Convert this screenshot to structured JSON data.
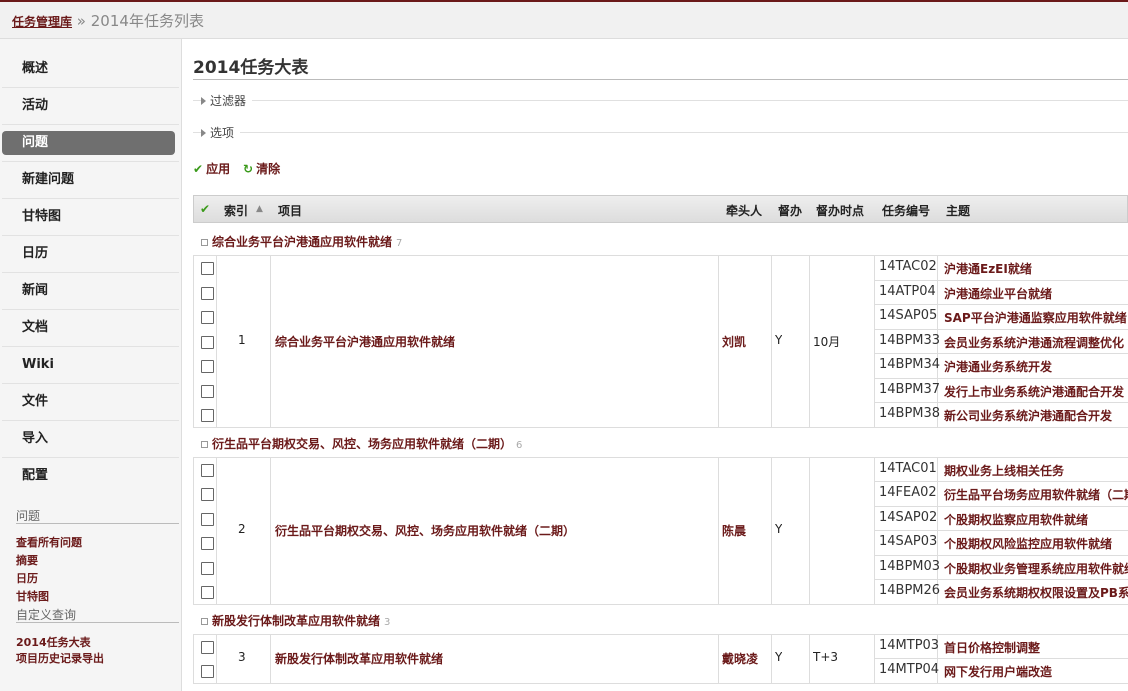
{
  "breadcrumb": {
    "root": "任务管理库",
    "sep": "»",
    "current": "2014年任务列表"
  },
  "sidebar": {
    "items": [
      {
        "label": "概述"
      },
      {
        "label": "活动"
      },
      {
        "label": "问题",
        "active": true
      },
      {
        "label": "新建问题"
      },
      {
        "label": "甘特图"
      },
      {
        "label": "日历"
      },
      {
        "label": "新闻"
      },
      {
        "label": "文档"
      },
      {
        "label": "Wiki"
      },
      {
        "label": "文件"
      },
      {
        "label": "导入"
      },
      {
        "label": "配置"
      }
    ],
    "issues_heading": "问题",
    "issue_links": [
      "查看所有问题",
      "摘要",
      "日历",
      "甘特图"
    ],
    "custom_heading": "自定义查询",
    "custom_links": [
      "2014任务大表",
      "项目历史记录导出"
    ]
  },
  "main": {
    "title": "2014任务大表",
    "filter_label": "过滤器",
    "options_label": "选项",
    "apply_label": "应用",
    "clear_label": "清除",
    "columns": [
      "索引",
      "项目",
      "牵头人",
      "督办",
      "督办时点",
      "任务编号",
      "主题"
    ],
    "groups": [
      {
        "name": "综合业务平台沪港通应用软件就绪",
        "count": "7",
        "index": "1",
        "project": "综合业务平台沪港通应用软件就绪",
        "lead": "刘凯",
        "supervise": "Y",
        "due": "10月",
        "tasks": [
          {
            "code": "14TAC02",
            "subject": "沪港通EzEI就绪"
          },
          {
            "code": "14ATP04",
            "subject": "沪港通综业平台就绪"
          },
          {
            "code": "14SAP05",
            "subject": "SAP平台沪港通监察应用软件就绪"
          },
          {
            "code": "14BPM33",
            "subject": "会员业务系统沪港通流程调整优化"
          },
          {
            "code": "14BPM34",
            "subject": "沪港通业务系统开发"
          },
          {
            "code": "14BPM37",
            "subject": "发行上市业务系统沪港通配合开发"
          },
          {
            "code": "14BPM38",
            "subject": "新公司业务系统沪港通配合开发"
          }
        ]
      },
      {
        "name": "衍生品平台期权交易、风控、场务应用软件就绪（二期）",
        "count": "6",
        "index": "2",
        "project": "衍生品平台期权交易、风控、场务应用软件就绪（二期）",
        "lead": "陈晨",
        "supervise": "Y",
        "due": "",
        "tasks": [
          {
            "code": "14TAC01",
            "subject": "期权业务上线相关任务"
          },
          {
            "code": "14FEA02",
            "subject": "衍生品平台场务应用软件就绪（二期）"
          },
          {
            "code": "14SAP02",
            "subject": "个股期权监察应用软件就绪"
          },
          {
            "code": "14SAP03",
            "subject": "个股期权风险监控应用软件就绪"
          },
          {
            "code": "14BPM03",
            "subject": "个股期权业务管理系统应用软件就绪"
          },
          {
            "code": "14BPM26",
            "subject": "会员业务系统期权权限设置及PB系统"
          }
        ]
      },
      {
        "name": "新股发行体制改革应用软件就绪",
        "count": "3",
        "index": "3",
        "project": "新股发行体制改革应用软件就绪",
        "lead": "戴晓凌",
        "supervise": "Y",
        "due": "T+3",
        "tasks": [
          {
            "code": "14MTP03",
            "subject": "首日价格控制调整"
          },
          {
            "code": "14MTP04",
            "subject": "网下发行用户端改造"
          }
        ]
      }
    ]
  }
}
